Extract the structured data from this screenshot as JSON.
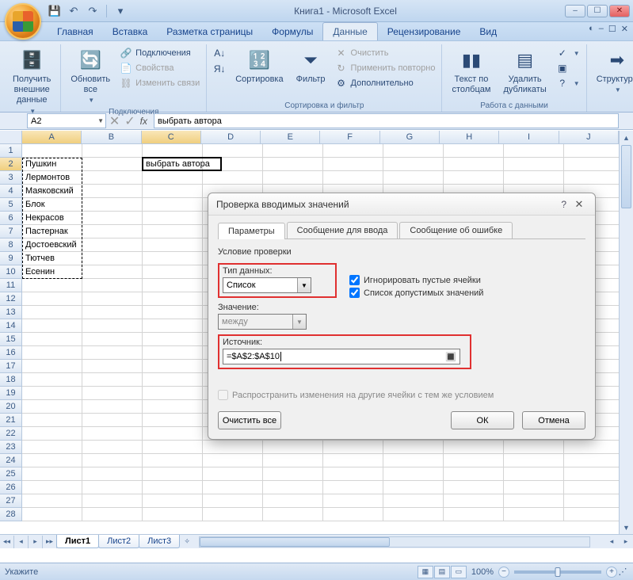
{
  "title": "Книга1 - Microsoft Excel",
  "qat": {
    "save": "💾",
    "undo": "↶",
    "redo": "↷"
  },
  "win": {
    "min": "–",
    "max": "☐",
    "close": "✕",
    "ribmin": "–",
    "ribhelp": "?"
  },
  "tabs": [
    "Главная",
    "Вставка",
    "Разметка страницы",
    "Формулы",
    "Данные",
    "Рецензирование",
    "Вид"
  ],
  "active_tab_index": 4,
  "ribbon": {
    "group1": {
      "btn": "Получить\nвнешние данные",
      "label": ""
    },
    "group2": {
      "btn": "Обновить\nвсе",
      "links": "Подключения",
      "props": "Свойства",
      "edit": "Изменить связи",
      "label": "Подключения"
    },
    "group3": {
      "az": "А↓Я",
      "za": "Я↓А",
      "sort": "Сортировка",
      "filter": "Фильтр",
      "clear": "Очистить",
      "reapply": "Применить повторно",
      "adv": "Дополнительно",
      "label": "Сортировка и фильтр"
    },
    "group4": {
      "t2c": "Текст по\nстолбцам",
      "dup": "Удалить\nдубликаты",
      "label": "Работа с данными"
    },
    "group5": {
      "btn": "Структура",
      "label": ""
    }
  },
  "namebox": "A2",
  "formula": "выбрать автора",
  "columns": [
    "A",
    "B",
    "C",
    "D",
    "E",
    "F",
    "G",
    "H",
    "I",
    "J"
  ],
  "rows_count": 28,
  "authors": [
    "Пушкин",
    "Лермонтов",
    "Маяковский",
    "Блок",
    "Некрасов",
    "Пастернак",
    "Достоевский",
    "Тютчев",
    "Есенин"
  ],
  "c2_value": "выбрать автора",
  "sheets": [
    "Лист1",
    "Лист2",
    "Лист3"
  ],
  "status": "Укажите",
  "zoom": "100%",
  "dialog": {
    "title": "Проверка вводимых значений",
    "tabs": [
      "Параметры",
      "Сообщение для ввода",
      "Сообщение об ошибке"
    ],
    "validation_group": "Условие проверки",
    "type_label": "Тип данных:",
    "type_value": "Список",
    "data_label": "Значение:",
    "data_value": "между",
    "source_label": "Источник:",
    "source_value": "=$A$2:$A$10",
    "ignore_blank": "Игнорировать пустые ячейки",
    "in_cell": "Список допустимых значений",
    "apply_all": "Распространить изменения на другие ячейки с тем же условием",
    "clear": "Очистить все",
    "ok": "ОК",
    "cancel": "Отмена"
  }
}
